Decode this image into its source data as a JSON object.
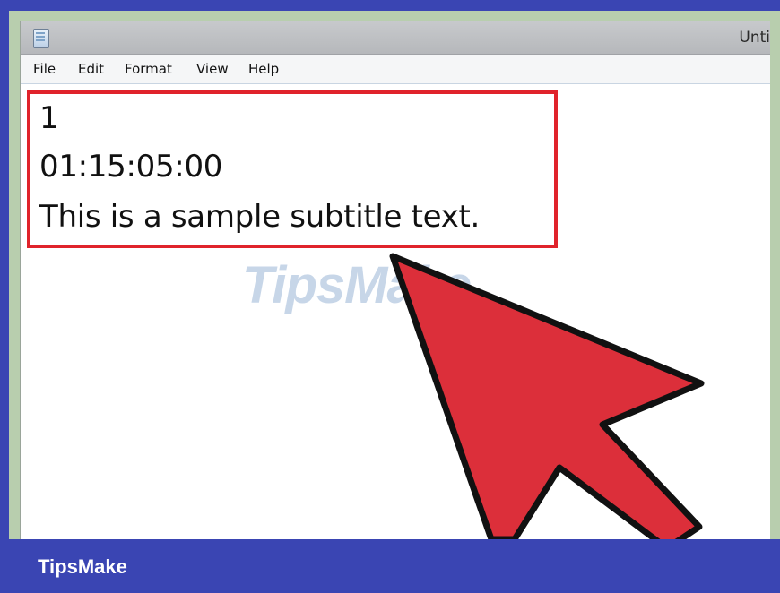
{
  "window": {
    "title": "Unti"
  },
  "menu": {
    "items": [
      "File",
      "Edit",
      "Format",
      "View",
      "Help"
    ]
  },
  "document": {
    "lines": [
      "1",
      "01:15:05:00",
      "This is a sample subtitle text."
    ]
  },
  "watermark": {
    "text": "TipsMake"
  },
  "footer": {
    "brand": "TipsMake"
  },
  "colors": {
    "highlight": "#e0232b",
    "arrow_fill": "#dc2f3a",
    "footer_bg": "#3a45b3"
  },
  "icons": {
    "app": "notepad-icon"
  }
}
